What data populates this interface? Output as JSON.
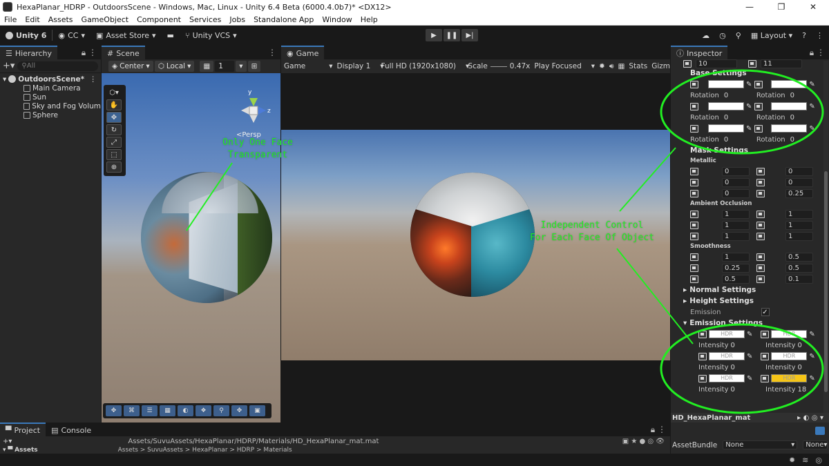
{
  "window": {
    "title": "HexaPlanar_HDRP - OutdoorsScene - Windows, Mac, Linux - Unity 6.4 Beta (6000.4.0b7)* <DX12>"
  },
  "menu": [
    "File",
    "Edit",
    "Assets",
    "GameObject",
    "Component",
    "Services",
    "Jobs",
    "Standalone App",
    "Window",
    "Help"
  ],
  "toolbar": {
    "unity": "Unity 6",
    "account": "CC",
    "asset_store": "Asset Store",
    "vcs": "Unity VCS",
    "layout": "Layout"
  },
  "hierarchy": {
    "tab": "Hierarchy",
    "search_placeholder": "All",
    "scene": "OutdoorsScene*",
    "items": [
      "Main Camera",
      "Sun",
      "Sky and Fog Volum",
      "Sphere"
    ]
  },
  "scene": {
    "tab": "Scene",
    "pivot": "Center",
    "space": "Local",
    "grid": "1",
    "persp": "<Persp",
    "gizmo_y": "y",
    "gizmo_z": "z"
  },
  "game": {
    "tab": "Game",
    "mode": "Game",
    "display": "Display 1",
    "resolution": "Full HD (1920x1080)",
    "scale_label": "Scale",
    "scale_value": "0.47x",
    "play_mode": "Play Focused",
    "stats": "Stats",
    "gizmos": "Gizm"
  },
  "inspector": {
    "tab": "Inspector",
    "top_values": [
      "10",
      "11"
    ],
    "base_settings": "Base Settings",
    "rotation_label": "Rotation",
    "base_rows": [
      {
        "left_rot": "0",
        "right_rot": "0"
      },
      {
        "left_rot": "0",
        "right_rot": "0"
      },
      {
        "left_rot": "0",
        "right_rot": "0"
      }
    ],
    "mask_settings": "Mask Settings",
    "metallic_label": "Metallic",
    "metallic": [
      [
        "0",
        "0"
      ],
      [
        "0",
        "0"
      ],
      [
        "0",
        "0.25"
      ]
    ],
    "ao_label": "Ambient Occlusion",
    "ao": [
      [
        "1",
        "1"
      ],
      [
        "1",
        "1"
      ],
      [
        "1",
        "1"
      ]
    ],
    "smoothness_label": "Smoothness",
    "smoothness": [
      [
        "1",
        "0.5"
      ],
      [
        "0.25",
        "0.5"
      ],
      [
        "0.5",
        "0.1"
      ]
    ],
    "normal_settings": "Normal Settings",
    "height_settings": "Height Settings",
    "emission_label": "Emission",
    "emission_settings": "Emission Settings",
    "hdr": "HDR",
    "intensity_label": "Intensity",
    "emission_rows": [
      {
        "left": "0",
        "right": "0"
      },
      {
        "left": "0",
        "right": "0"
      },
      {
        "left": "0",
        "right": "18"
      }
    ],
    "material_name": "HD_HexaPlanar_mat",
    "asset_bundle_label": "AssetBundle",
    "asset_bundle_value": "None",
    "asset_bundle_variant": "None"
  },
  "project": {
    "tab_project": "Project",
    "tab_console": "Console",
    "path": "Assets/SuvuAssets/HexaPlanar/HDRP/Materials/HD_HexaPlanar_mat.mat",
    "breadcrumb": "Assets > SuvuAssets > HexaPlanar > HDRP > Materials",
    "assets": "Assets"
  },
  "annotations": {
    "one_face_line1": "Only One Face",
    "one_face_line2": "Transparent",
    "independent_line1": "Independent Control",
    "independent_line2": "For Each Face Of Object"
  },
  "colors": {
    "annotation": "#22ee22",
    "accent": "#3a79bb",
    "emission_hdr": "#f5c518"
  }
}
